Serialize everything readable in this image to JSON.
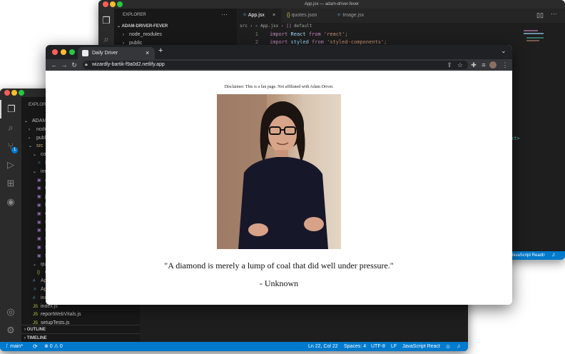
{
  "back_window": {
    "title": "App.jsx — adam-driver-fever",
    "explorer_label": "EXPLORER",
    "project": "ADAM-DRIVER-FEVER",
    "tree": [
      "node_modules",
      "public"
    ],
    "tabs": [
      {
        "label": "App.jsx",
        "active": true
      },
      {
        "label": "quotes.json",
        "active": false
      },
      {
        "label": "Image.jsx",
        "active": false
      }
    ],
    "breadcrumb": [
      "src",
      "App.jsx",
      "default"
    ],
    "code": [
      {
        "num": "1",
        "kw": "import",
        "name": "React",
        "from": "from",
        "str": "'react';"
      },
      {
        "num": "2",
        "kw": "import",
        "name": "styled",
        "from": "from",
        "str": "'styled-components';"
      }
    ],
    "peek_code": "xt>",
    "status_right": "JavaScript React"
  },
  "front_window": {
    "explorer_label": "EXPLORE",
    "tree": [
      {
        "label": "ADAM-D",
        "indent": 0,
        "icon": "chevron-down"
      },
      {
        "label": "node_",
        "indent": 1,
        "icon": "chevron-right"
      },
      {
        "label": "publi",
        "indent": 1,
        "icon": "chevron-right"
      },
      {
        "label": "src",
        "indent": 1,
        "icon": "chevron-down"
      },
      {
        "label": "com",
        "indent": 2,
        "icon": "chevron-down"
      },
      {
        "label": "Im",
        "indent": 3,
        "icon": "react"
      },
      {
        "label": "ima",
        "indent": 2,
        "icon": "chevron-down"
      },
      {
        "label": "alm",
        "indent": 3,
        "icon": "image"
      },
      {
        "label": "in-",
        "indent": 3,
        "icon": "image"
      },
      {
        "label": "jea",
        "indent": 3,
        "icon": "image"
      },
      {
        "label": "kyl",
        "indent": 3,
        "icon": "image"
      },
      {
        "label": "on",
        "indent": 3,
        "icon": "image"
      },
      {
        "label": "se",
        "indent": 3,
        "icon": "image"
      },
      {
        "label": "se",
        "indent": 3,
        "icon": "image"
      },
      {
        "label": "sh",
        "indent": 3,
        "icon": "image"
      },
      {
        "label": "sin",
        "indent": 3,
        "icon": "image"
      },
      {
        "label": "sm",
        "indent": 3,
        "icon": "image"
      },
      {
        "label": "quo",
        "indent": 2,
        "icon": "chevron-down"
      },
      {
        "label": "qu",
        "indent": 3,
        "icon": "json"
      },
      {
        "label": "App",
        "indent": 2,
        "icon": "css"
      },
      {
        "label": "App",
        "indent": 2,
        "icon": "react"
      },
      {
        "label": "inde",
        "indent": 2,
        "icon": "css"
      },
      {
        "label": "index.js",
        "indent": 2,
        "icon": "js"
      },
      {
        "label": "reportWebVitals.js",
        "indent": 2,
        "icon": "js"
      },
      {
        "label": "setupTests.js",
        "indent": 2,
        "icon": "js"
      }
    ],
    "sections": [
      "OUTLINE",
      "TIMELINE"
    ],
    "source_control_badge": "1",
    "status": {
      "branch": "main*",
      "problems": "⊗ 0 ⚠ 0",
      "position": "Ln 22, Col 22",
      "spaces": "Spaces: 4",
      "encoding": "UTF-8",
      "eol": "LF",
      "language": "JavaScript React"
    }
  },
  "browser": {
    "tab_title": "Daily Driver",
    "url": "wizardly-bartik-f9a0d2.netlify.app",
    "disclaimer": "Disclaimer: This is a fan page. Not affiliated with Adam Driver.",
    "quote": "\"A diamond is merely a lump of coal that did well under pressure.\"",
    "author": "- Unknown"
  }
}
